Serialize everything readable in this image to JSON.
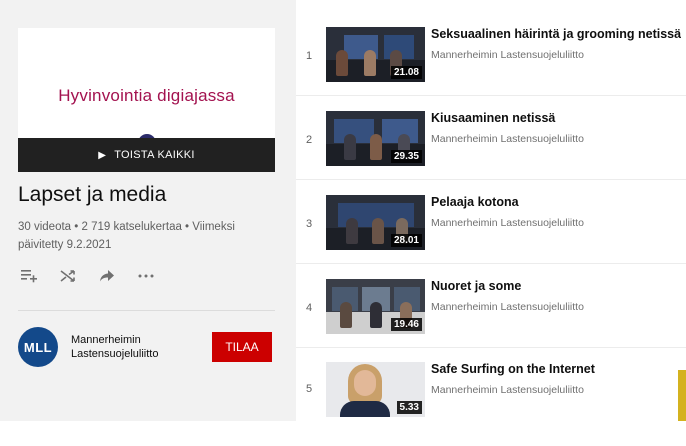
{
  "playlist": {
    "thumbnail_text": "Hyvinvointia digiajassa",
    "play_all_label": "TOISTA KAIKKI",
    "title": "Lapset ja media",
    "meta": "30 videota • 2 719 katselukertaa • Viimeksi päivitetty 9.2.2021",
    "actions": [
      "add-to-queue-icon",
      "shuffle-icon",
      "share-icon",
      "more-icon"
    ]
  },
  "channel": {
    "avatar_text": "MLL",
    "name": "Mannerheimin Lastensuojeluliitto",
    "subscribe_label": "TILAA"
  },
  "videos": [
    {
      "index": "1",
      "title": "Seksuaalinen häirintä ja grooming netissä",
      "channel": "Mannerheimin Lastensuojeluliitto",
      "duration": "21.08"
    },
    {
      "index": "2",
      "title": "Kiusaaminen netissä",
      "channel": "Mannerheimin Lastensuojeluliitto",
      "duration": "29.35"
    },
    {
      "index": "3",
      "title": "Pelaaja kotona",
      "channel": "Mannerheimin Lastensuojeluliitto",
      "duration": "28.01"
    },
    {
      "index": "4",
      "title": "Nuoret ja some",
      "channel": "Mannerheimin Lastensuojeluliitto",
      "duration": "19.46"
    },
    {
      "index": "5",
      "title": "Safe Surfing on the Internet",
      "channel": "Mannerheimin Lastensuojeluliitto",
      "duration": "5.33"
    }
  ],
  "colors": {
    "subscribe": "#cc0000",
    "thumbnail_title": "#a3124f",
    "avatar": "#13498a"
  }
}
